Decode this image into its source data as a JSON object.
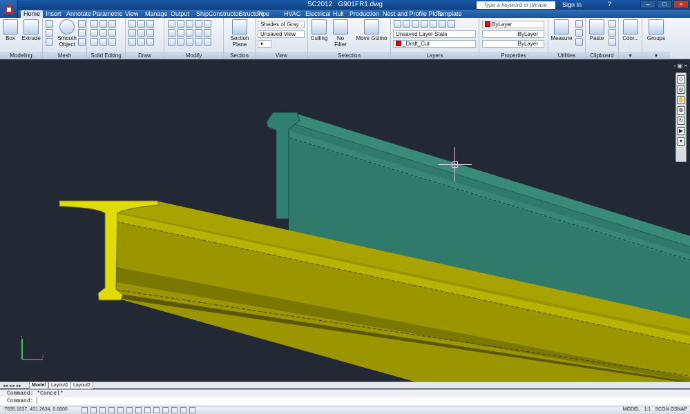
{
  "title": {
    "app": "SC2012",
    "file": "G901FR1.dwg"
  },
  "search": {
    "placeholder": "Type a keyword or phrase"
  },
  "signin": "Sign In",
  "tabs": [
    "Home",
    "Insert",
    "Annotate",
    "Parametric",
    "View",
    "Manage",
    "Output",
    "ShipConstructor",
    "Structure",
    "Pipe",
    "HVAC",
    "Electrical",
    "Hull",
    "Production",
    "Nest and Profile Plots",
    "Template"
  ],
  "ribbon": {
    "modeling": {
      "title": "Modeling",
      "box": "Box",
      "extrude": "Extrude"
    },
    "mesh": {
      "title": "Mesh",
      "smooth": "Smooth Object"
    },
    "solid_editing": {
      "title": "Solid Editing"
    },
    "draw": {
      "title": "Draw"
    },
    "modify": {
      "title": "Modify"
    },
    "section": {
      "title": "Section",
      "plane": "Section Plane"
    },
    "view": {
      "title": "View",
      "visual_style": "Shades of Gray",
      "named_view": "Unsaved View"
    },
    "selection": {
      "title": "Selection",
      "culling": "Culling",
      "no_filter": "No Filter",
      "move_gizmo": "Move Gizmo"
    },
    "layers": {
      "title": "Layers",
      "layer_state": "Unsaved Layer State",
      "current_layer": "_Draft_Cut"
    },
    "properties": {
      "title": "Properties",
      "color": "ByLayer",
      "linetype": "ByLayer",
      "lineweight": "ByLayer"
    },
    "utilities": {
      "title": "Utilities",
      "measure": "Measure"
    },
    "clipboard": {
      "title": "Clipboard",
      "paste": "Paste"
    },
    "coord": {
      "label": "Coor..."
    },
    "groups": {
      "label": "Groups"
    }
  },
  "layout_tabs": [
    "Model",
    "Layout1",
    "Layout2"
  ],
  "command": {
    "history": "Command: *Cancel*",
    "prompt": "Command:"
  },
  "status": {
    "coords": "-7635.1637, 431.2634, 0.0000",
    "model": "MODEL",
    "scale": "1:1",
    "snap": "SCON OSNAP"
  },
  "colors": {
    "beam_near": "#c9c400",
    "beam_far": "#2f7a6a",
    "viewport_bg": "#222934"
  }
}
